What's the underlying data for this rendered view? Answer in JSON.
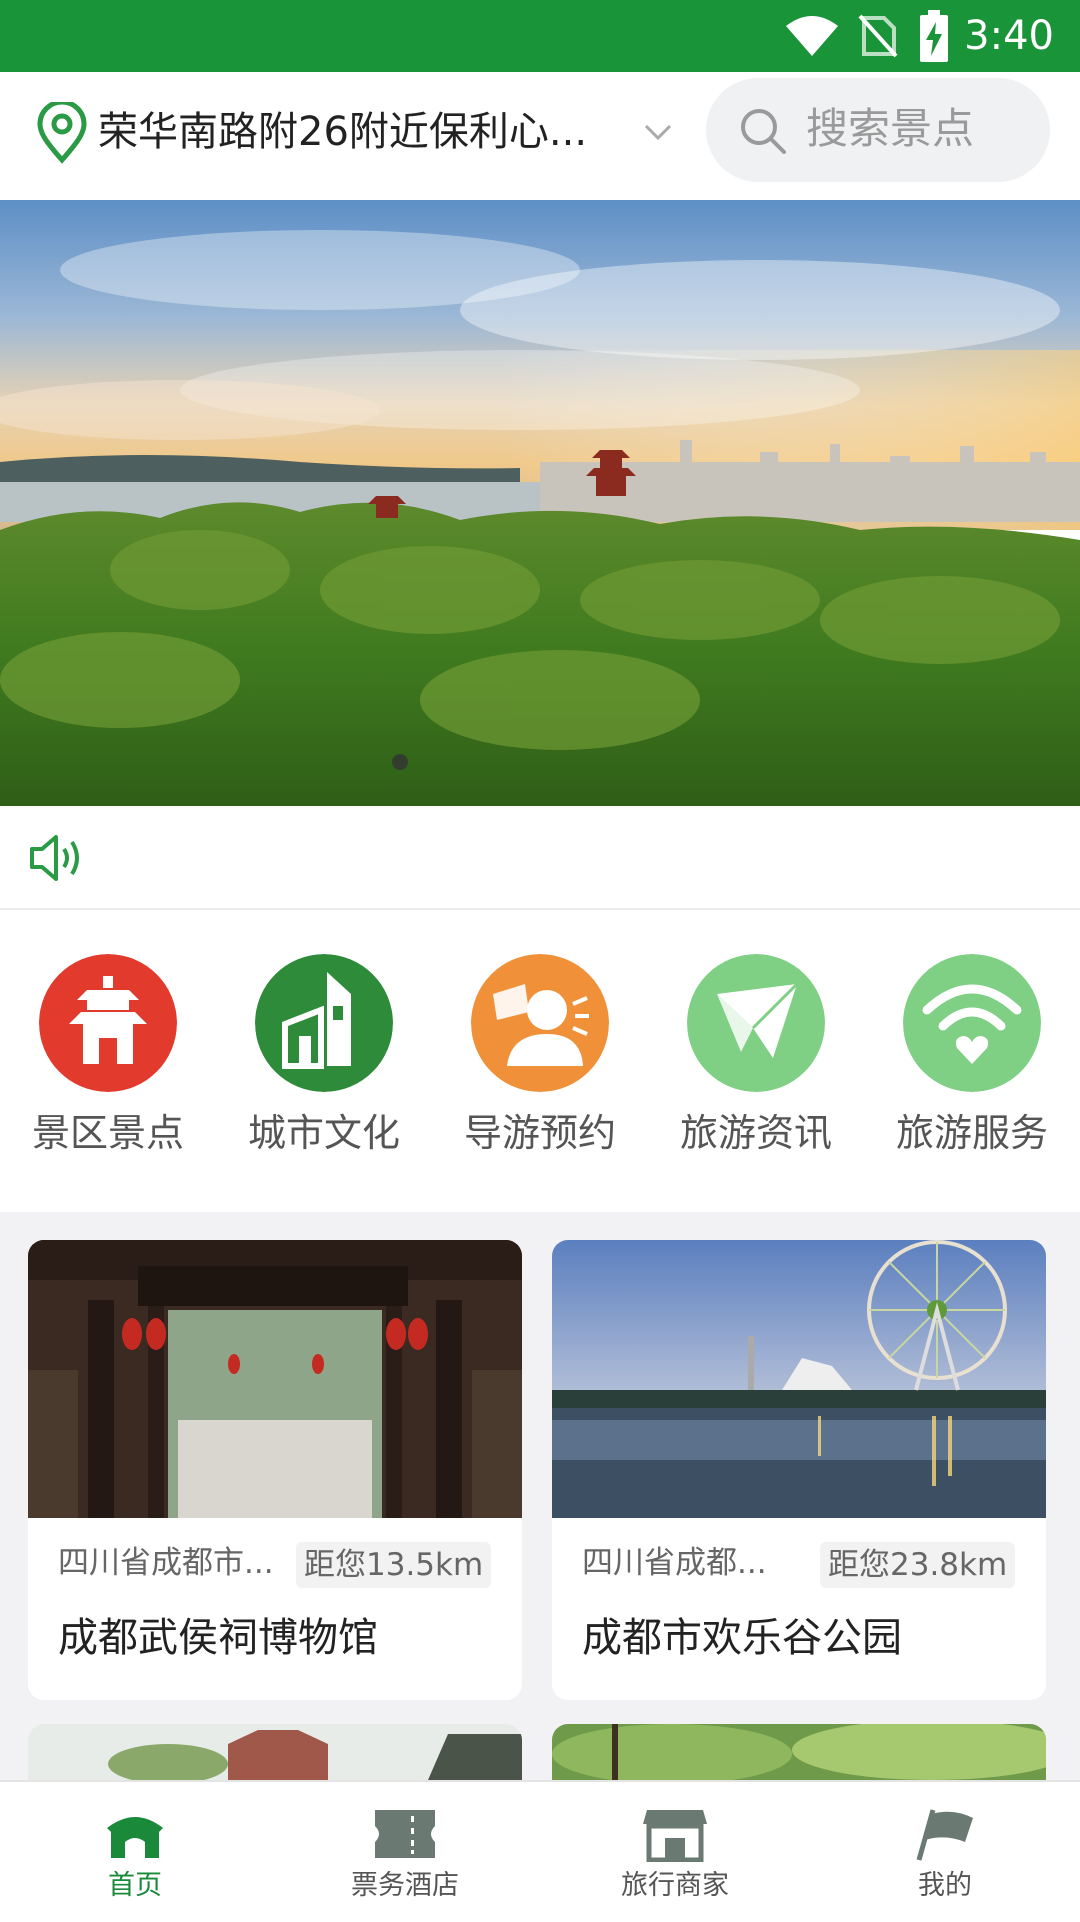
{
  "status_bar": {
    "time": "3:40"
  },
  "header": {
    "location": "荣华南路附26附近保利心...",
    "search_placeholder": "搜索景点"
  },
  "categories": [
    {
      "label": "景区景点",
      "icon": "pavilion-icon",
      "color": "#e23b2e"
    },
    {
      "label": "城市文化",
      "icon": "city-building-icon",
      "color": "#2e8b3a"
    },
    {
      "label": "导游预约",
      "icon": "tour-guide-icon",
      "color": "#f0913a"
    },
    {
      "label": "旅游资讯",
      "icon": "paper-plane-icon",
      "color": "#7fcf84"
    },
    {
      "label": "旅游服务",
      "icon": "wifi-service-icon",
      "color": "#7fcf84"
    }
  ],
  "cards": [
    {
      "region": "四川省成都市...",
      "distance": "距您13.5km",
      "title": "成都武侯祠博物馆"
    },
    {
      "region": "四川省成都...",
      "distance": "距您23.8km",
      "title": "成都市欢乐谷公园"
    }
  ],
  "nav": [
    {
      "label": "首页",
      "icon": "home-gate-icon",
      "active": true
    },
    {
      "label": "票务酒店",
      "icon": "ticket-icon",
      "active": false
    },
    {
      "label": "旅行商家",
      "icon": "shop-icon",
      "active": false
    },
    {
      "label": "我的",
      "icon": "flag-icon",
      "active": false
    }
  ],
  "colors": {
    "brand_green": "#1a9438",
    "active_nav": "#1a8a3a"
  }
}
